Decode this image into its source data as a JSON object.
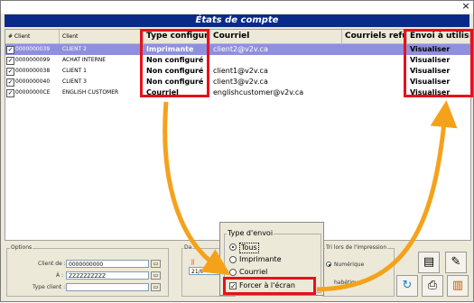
{
  "window": {
    "close_glyph": "×"
  },
  "banner": {
    "title": "États de compte"
  },
  "table": {
    "columns": {
      "client_num": "# Client",
      "client": "Client",
      "type": "Type configuré",
      "courriel": "Courriel",
      "courriels_refuses": "Courriels refusés",
      "envoi": "Envoi à utiliser"
    },
    "rows": [
      {
        "checked": "✓",
        "num": "0000000039",
        "client": "CLIENT 2",
        "type": "Imprimante",
        "courriel": "client2@v2v.ca",
        "envoi": "Visualiser"
      },
      {
        "checked": "✓",
        "num": "0000000099",
        "client": "ACHAT INTERNE",
        "type": "Non configuré",
        "courriel": "",
        "envoi": "Visualiser"
      },
      {
        "checked": "✓",
        "num": "0000000038",
        "client": "CLIENT 1",
        "type": "Non configuré",
        "courriel": "client1@v2v.ca",
        "envoi": "Visualiser"
      },
      {
        "checked": "✓",
        "num": "0000000040",
        "client": "CLIENT 3",
        "type": "Non configuré",
        "courriel": "client3@v2v.ca",
        "envoi": "Visualiser"
      },
      {
        "checked": "✓",
        "num": "00000000CE",
        "client": "ENGLISH CUSTOMER",
        "type": "Courriel",
        "courriel": "englishcustomer@v2v.ca",
        "envoi": "Visualiser"
      }
    ]
  },
  "options": {
    "label": "Options",
    "client_de_label": "Client de :",
    "client_de_value": "0000000000",
    "a_label": "À :",
    "a_value": "ZZZZZZZZZZ",
    "type_client_label": "Type client :"
  },
  "date": {
    "label": "Da",
    "prefix": "JJ",
    "value": "21/0"
  },
  "type_envoi": {
    "label": "Type d'envoi",
    "tous": "Tous",
    "imprimante": "Imprimante",
    "courriel": "Courriel",
    "forcer": "Forcer à l'écran"
  },
  "tri": {
    "label": "Tri lors de l'impression",
    "numerique": "Numérique",
    "alphabetique": "habétique"
  },
  "colors": {
    "banner": "#0a2a8a",
    "highlight": "#e8101c",
    "arrow": "#f5a21b",
    "selected_row": "#8f8fe0"
  },
  "icons": [
    "close-icon",
    "folder-icon",
    "document-icon",
    "eraser-icon",
    "refresh-icon",
    "printer-icon",
    "exit-icon"
  ]
}
